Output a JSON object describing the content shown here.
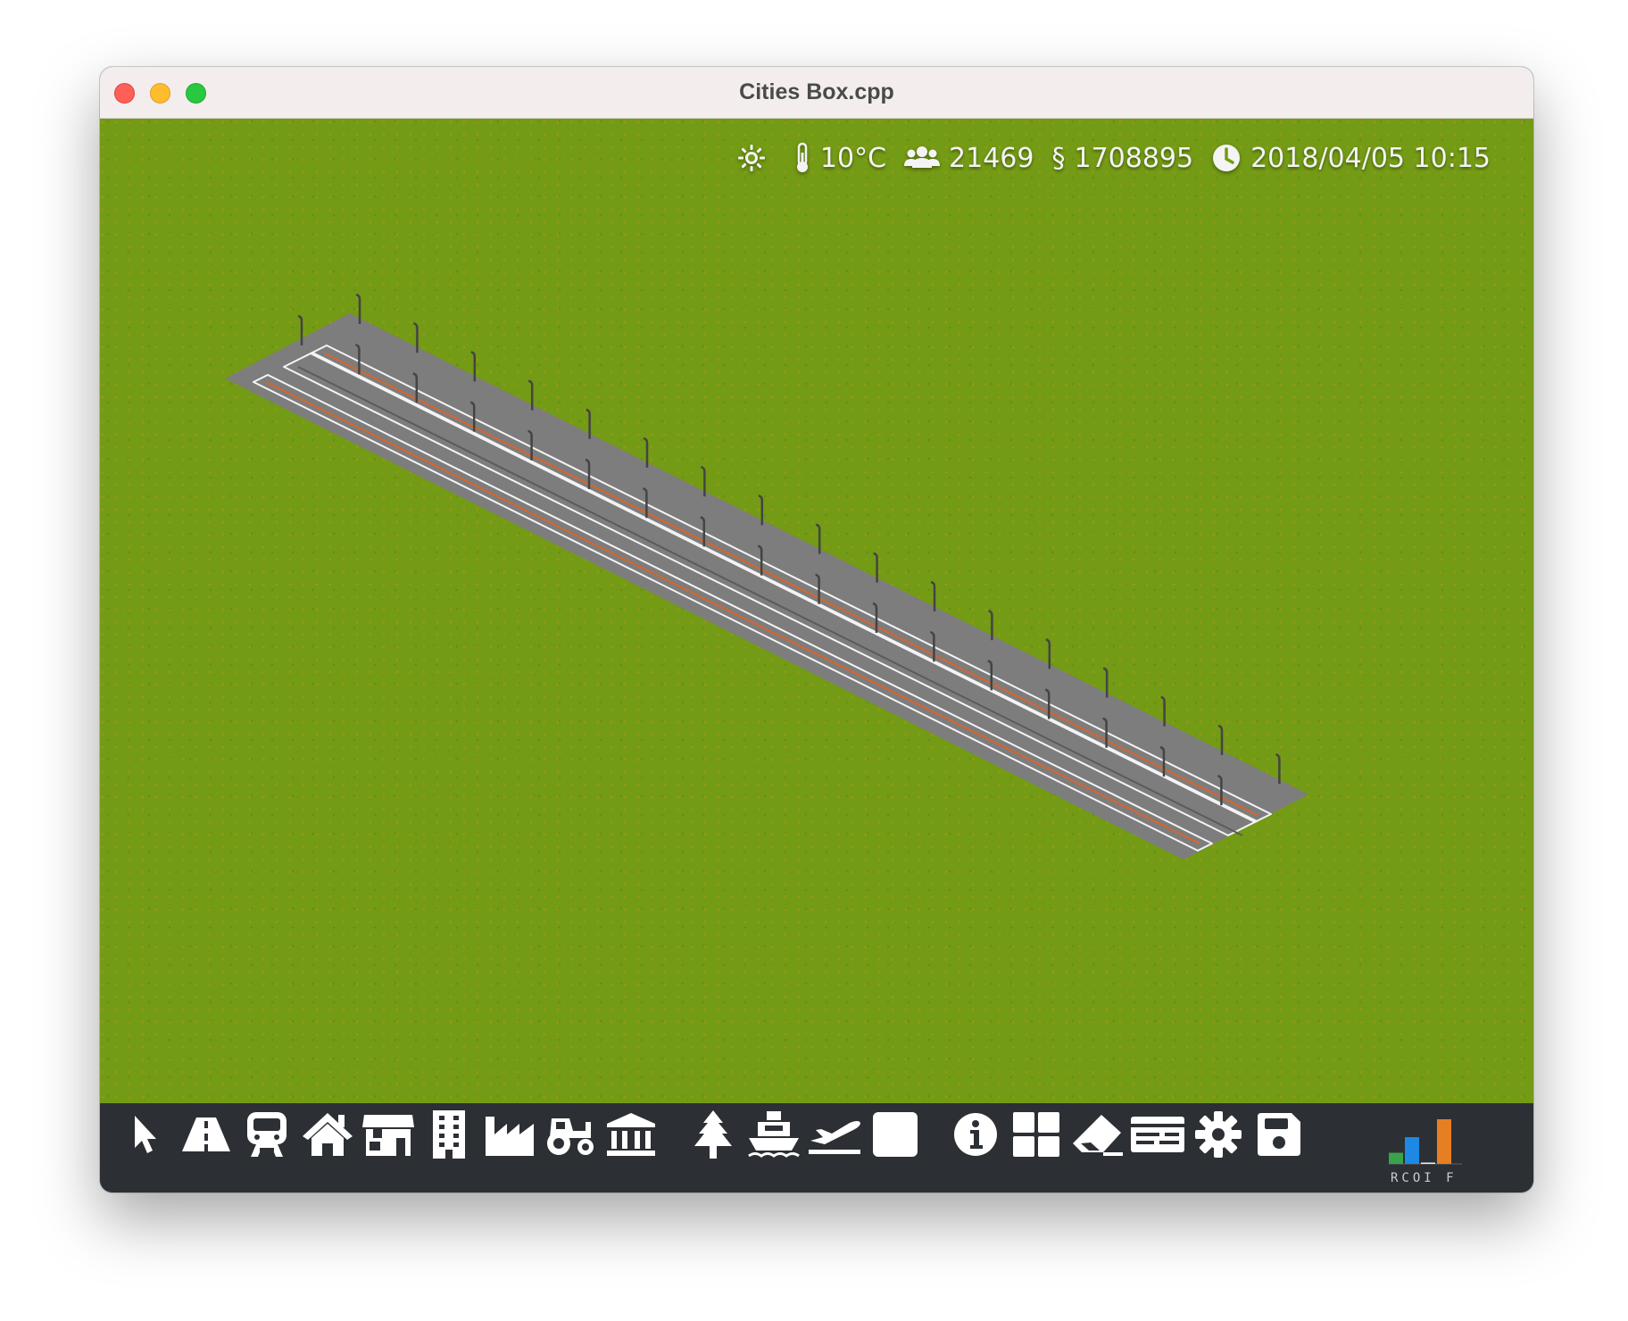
{
  "window": {
    "title": "Cities Box.cpp"
  },
  "hud": {
    "weather_icon": "sun-icon",
    "temperature_icon": "thermometer-icon",
    "temperature": "10°C",
    "population_icon": "people-icon",
    "population": "21469",
    "money_icon": "section-sign-icon",
    "money_symbol": "§",
    "money": "1708895",
    "clock_icon": "clock-icon",
    "datetime": "2018/04/05 10:15"
  },
  "toolbar": {
    "tools": [
      "select",
      "road",
      "rail",
      "residential",
      "commercial",
      "office",
      "industrial",
      "farm",
      "public-services",
      "park",
      "port",
      "airport",
      "blank",
      "info",
      "overlays",
      "bulldoze",
      "finance",
      "settings",
      "save"
    ]
  },
  "rcoif": {
    "label": "RCOI F",
    "colors": {
      "R": "#3aa24a",
      "C": "#1e88e5",
      "O": "#f0f0f0",
      "I": "#e67e22"
    },
    "levels": {
      "R": 0.25,
      "C": 0.6,
      "O": 0.03,
      "I": 1.0
    }
  },
  "colors": {
    "grass": "#739b15",
    "track_bed": "#7d7d7d",
    "rail_line": "#d9642b",
    "toolbar_bg": "#2c3034"
  }
}
